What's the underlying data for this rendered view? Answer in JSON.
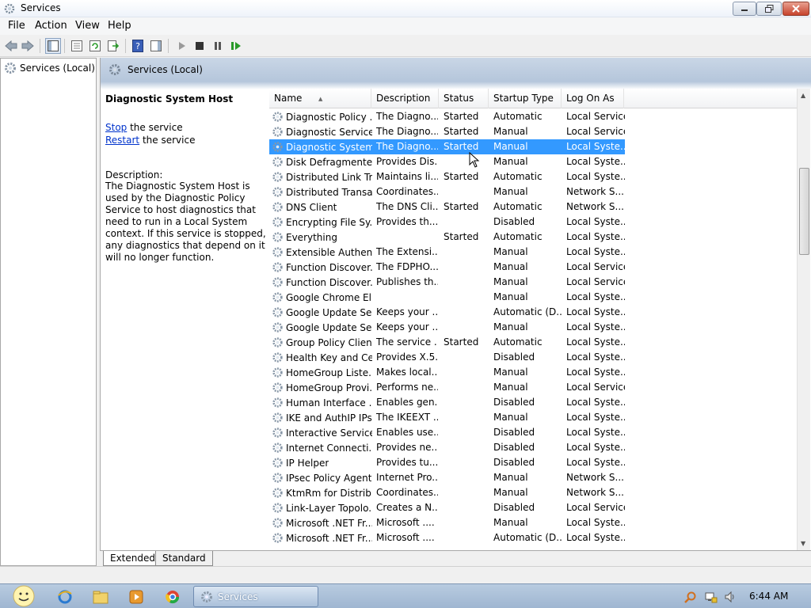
{
  "window": {
    "title": "Services"
  },
  "menu": [
    "File",
    "Action",
    "View",
    "Help"
  ],
  "tree": {
    "root_label": "Services (Local)"
  },
  "main": {
    "header_title": "Services (Local)"
  },
  "details": {
    "service_title": "Diagnostic System Host",
    "stop_link": "Stop",
    "stop_suffix": " the service",
    "restart_link": "Restart",
    "restart_suffix": " the service",
    "description_label": "Description:",
    "description": "The Diagnostic System Host is used by the Diagnostic Policy Service to host diagnostics that need to run in a Local System context.  If this service is stopped, any diagnostics that depend on it will no longer function."
  },
  "columns": [
    "Name",
    "Description",
    "Status",
    "Startup Type",
    "Log On As"
  ],
  "selected_row_index": 2,
  "rows": [
    [
      "Diagnostic Policy ...",
      "The Diagno...",
      "Started",
      "Automatic",
      "Local Service"
    ],
    [
      "Diagnostic Service...",
      "The Diagno...",
      "Started",
      "Manual",
      "Local Service"
    ],
    [
      "Diagnostic System...",
      "The Diagno...",
      "Started",
      "Manual",
      "Local Syste..."
    ],
    [
      "Disk Defragmenter",
      "Provides Dis...",
      "",
      "Manual",
      "Local Syste..."
    ],
    [
      "Distributed Link Tr...",
      "Maintains li...",
      "Started",
      "Automatic",
      "Local Syste..."
    ],
    [
      "Distributed Transa...",
      "Coordinates...",
      "",
      "Manual",
      "Network S..."
    ],
    [
      "DNS Client",
      "The DNS Cli...",
      "Started",
      "Automatic",
      "Network S..."
    ],
    [
      "Encrypting File Sy...",
      "Provides th...",
      "",
      "Disabled",
      "Local Syste..."
    ],
    [
      "Everything",
      "",
      "Started",
      "Automatic",
      "Local Syste..."
    ],
    [
      "Extensible Authen...",
      "The Extensi...",
      "",
      "Manual",
      "Local Syste..."
    ],
    [
      "Function Discover...",
      "The FDPHO...",
      "",
      "Manual",
      "Local Service"
    ],
    [
      "Function Discover...",
      "Publishes th...",
      "",
      "Manual",
      "Local Service"
    ],
    [
      "Google Chrome El...",
      "",
      "",
      "Manual",
      "Local Syste..."
    ],
    [
      "Google Update Se...",
      "Keeps your ...",
      "",
      "Automatic (D...",
      "Local Syste..."
    ],
    [
      "Google Update Se...",
      "Keeps your ...",
      "",
      "Manual",
      "Local Syste..."
    ],
    [
      "Group Policy Client",
      "The service ...",
      "Started",
      "Automatic",
      "Local Syste..."
    ],
    [
      "Health Key and Ce...",
      "Provides X.5...",
      "",
      "Disabled",
      "Local Syste..."
    ],
    [
      "HomeGroup Liste...",
      "Makes local...",
      "",
      "Manual",
      "Local Syste..."
    ],
    [
      "HomeGroup Provi...",
      "Performs ne...",
      "",
      "Manual",
      "Local Service"
    ],
    [
      "Human Interface ...",
      "Enables gen...",
      "",
      "Disabled",
      "Local Syste..."
    ],
    [
      "IKE and AuthIP IPs...",
      "The IKEEXT ...",
      "",
      "Manual",
      "Local Syste..."
    ],
    [
      "Interactive Service...",
      "Enables use...",
      "",
      "Disabled",
      "Local Syste..."
    ],
    [
      "Internet Connecti...",
      "Provides ne...",
      "",
      "Disabled",
      "Local Syste..."
    ],
    [
      "IP Helper",
      "Provides tu...",
      "",
      "Disabled",
      "Local Syste..."
    ],
    [
      "IPsec Policy Agent",
      "Internet Pro...",
      "",
      "Manual",
      "Network S..."
    ],
    [
      "KtmRm for Distrib...",
      "Coordinates...",
      "",
      "Manual",
      "Network S..."
    ],
    [
      "Link-Layer Topolo...",
      "Creates a N...",
      "",
      "Disabled",
      "Local Service"
    ],
    [
      "Microsoft .NET Fr...",
      "Microsoft ....",
      "",
      "Manual",
      "Local Syste..."
    ],
    [
      "Microsoft .NET Fr...",
      "Microsoft ....",
      "",
      "Automatic (D...",
      "Local Syste..."
    ]
  ],
  "tabs": [
    "Extended",
    "Standard"
  ],
  "taskbar": {
    "active_app": "Services",
    "clock": "6:44 AM"
  },
  "colors": {
    "selection": "#3399ff",
    "link": "#0033cc",
    "header_band": "#b5c6db"
  }
}
